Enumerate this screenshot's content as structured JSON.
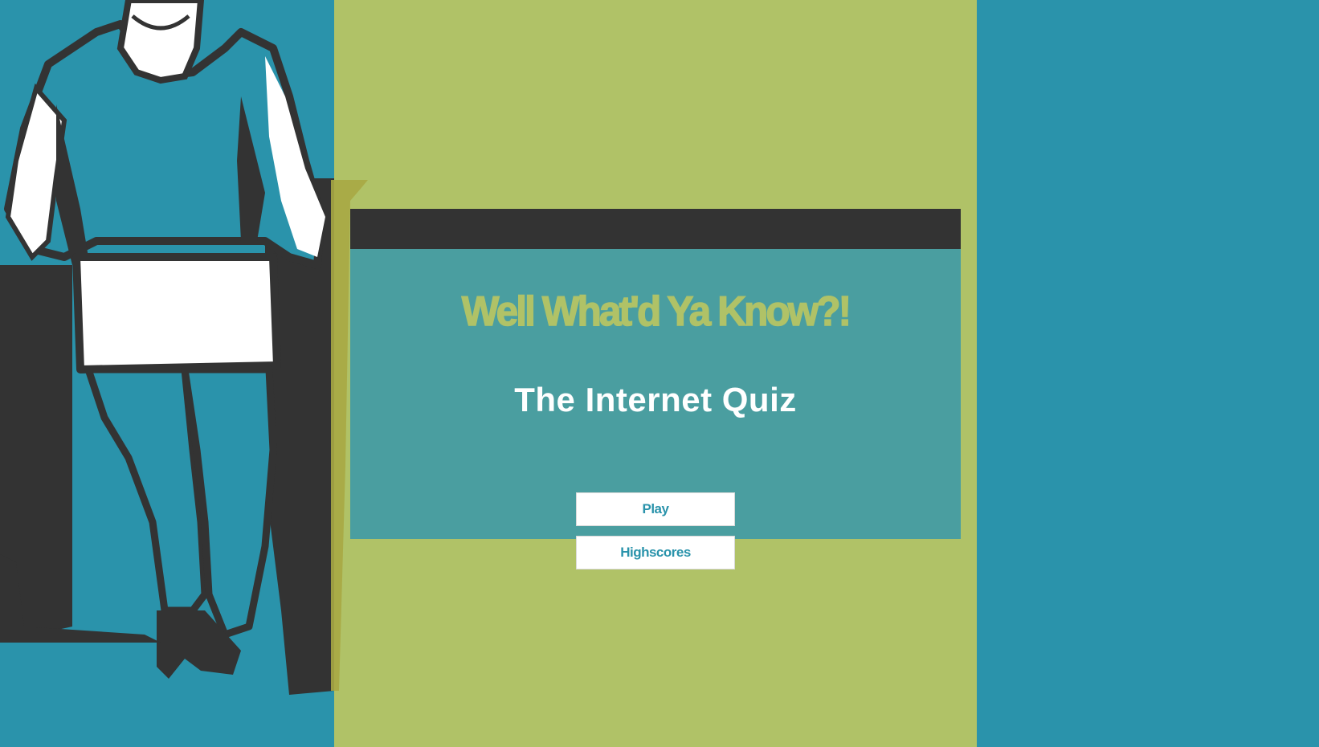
{
  "colors": {
    "teal_background": "#2a93ab",
    "olive_column": "#b0c267",
    "card_header": "#333333",
    "card_body": "#4a9ea0",
    "title_text": "#b0c267",
    "subtitle_text": "#ffffff",
    "button_background": "#ffffff",
    "button_text": "#2a93ab"
  },
  "illustration": {
    "description_icon": "person-with-laptop-icon"
  },
  "card": {
    "title": "Well What'd Ya Know?!",
    "subtitle": "The Internet Quiz",
    "buttons": {
      "play_label": "Play",
      "highscores_label": "Highscores"
    }
  }
}
